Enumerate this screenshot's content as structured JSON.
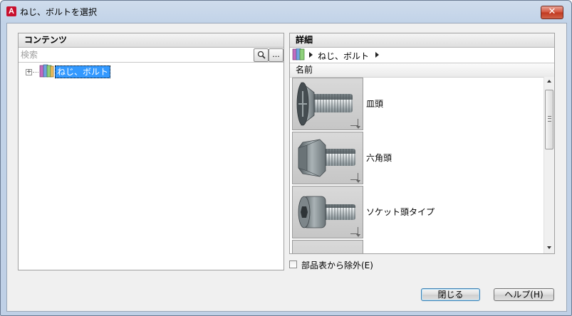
{
  "window": {
    "title": "ねじ、ボルトを選択",
    "app_icon_letter": "A",
    "close_symbol": "✕"
  },
  "contents_panel": {
    "header": "コンテンツ",
    "search": {
      "placeholder": "検索",
      "search_icon": "magnifier-icon",
      "more_button": "..."
    },
    "tree": [
      {
        "label": "ねじ、ボルト",
        "selected": true,
        "expander": "+"
      }
    ]
  },
  "details_panel": {
    "header": "詳細",
    "breadcrumb": "ねじ、ボルト",
    "column_header": "名前",
    "items": [
      {
        "label": "皿頭",
        "icon": "countersunk-screw-icon"
      },
      {
        "label": "六角頭",
        "icon": "hex-head-bolt-icon"
      },
      {
        "label": "ソケット頭タイプ",
        "icon": "socket-head-screw-icon"
      }
    ]
  },
  "exclude_checkbox": {
    "label": "部品表から除外(E)",
    "checked": false
  },
  "buttons": {
    "close": "閉じる",
    "help": "ヘルプ(H)"
  },
  "colors": {
    "selection": "#3399ff",
    "title_gradient": "#c2d3e8",
    "close_button": "#c0391f"
  }
}
